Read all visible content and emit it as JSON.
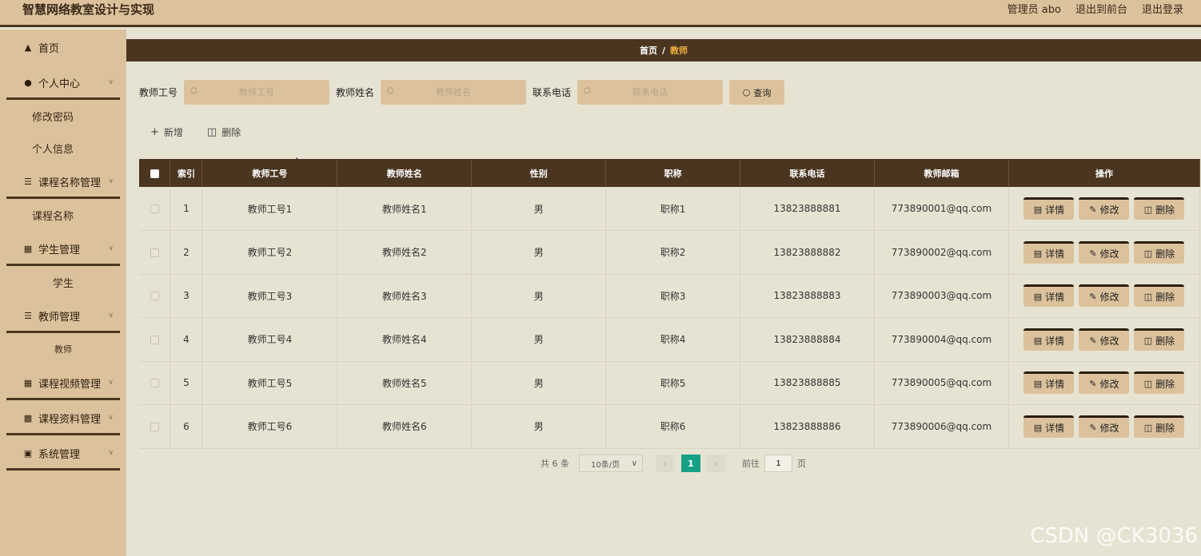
{
  "header": {
    "title": "智慧网络教室设计与实现",
    "admin": "管理员 abo",
    "to_front": "退出到前台",
    "logout": "退出登录"
  },
  "sidebar": {
    "home": "首页",
    "personal_center": "个人中心",
    "change_password": "修改密码",
    "personal_info": "个人信息",
    "course_name_mgmt": "课程名称管理",
    "course_name": "课程名称",
    "student_mgmt": "学生管理",
    "student": "学生",
    "teacher_mgmt": "教师管理",
    "teacher": "教师",
    "course_video_mgmt": "课程视频管理",
    "course_material_mgmt": "课程资料管理",
    "system_mgmt": "系统管理"
  },
  "breadcrumb": {
    "home": "首页",
    "separator": "/",
    "current": "教师"
  },
  "search": {
    "teacher_no_label": "教师工号",
    "teacher_no_placeholder": "教师工号",
    "teacher_name_label": "教师姓名",
    "teacher_name_placeholder": "教师姓名",
    "phone_label": "联系电话",
    "phone_placeholder": "联系电话",
    "query_button": "查询"
  },
  "actions": {
    "add": "新增",
    "delete": "删除"
  },
  "table": {
    "columns": [
      "索引",
      "教师工号",
      "教师姓名",
      "性别",
      "职称",
      "联系电话",
      "教师邮箱",
      "操作"
    ],
    "rows": [
      {
        "index": "1",
        "no": "教师工号1",
        "name": "教师姓名1",
        "gender": "男",
        "title": "职称1",
        "phone": "13823888881",
        "email": "773890001@qq.com"
      },
      {
        "index": "2",
        "no": "教师工号2",
        "name": "教师姓名2",
        "gender": "男",
        "title": "职称2",
        "phone": "13823888882",
        "email": "773890002@qq.com"
      },
      {
        "index": "3",
        "no": "教师工号3",
        "name": "教师姓名3",
        "gender": "男",
        "title": "职称3",
        "phone": "13823888883",
        "email": "773890003@qq.com"
      },
      {
        "index": "4",
        "no": "教师工号4",
        "name": "教师姓名4",
        "gender": "男",
        "title": "职称4",
        "phone": "13823888884",
        "email": "773890004@qq.com"
      },
      {
        "index": "5",
        "no": "教师工号5",
        "name": "教师姓名5",
        "gender": "男",
        "title": "职称5",
        "phone": "13823888885",
        "email": "773890005@qq.com"
      },
      {
        "index": "6",
        "no": "教师工号6",
        "name": "教师姓名6",
        "gender": "男",
        "title": "职称6",
        "phone": "13823888886",
        "email": "773890006@qq.com"
      }
    ],
    "row_buttons": {
      "detail": "详情",
      "edit": "修改",
      "delete": "删除"
    }
  },
  "pagination": {
    "total": "共 6 条",
    "page_size": "10条/页",
    "current_page": "1",
    "goto_label": "前往",
    "goto_value": "1",
    "page_suffix": "页"
  },
  "watermark": "CSDN @CK3036",
  "icons": {
    "home": "home-icon",
    "user": "user-icon",
    "list": "list-icon",
    "grid": "grid-icon",
    "search": "search-icon",
    "plus": "plus-icon",
    "trash": "trash-icon",
    "detail": "document-icon",
    "edit": "pencil-icon"
  },
  "colors": {
    "header_bg": "#dcc29c",
    "dark_brown": "#4a3520",
    "content_bg": "#e6e3d2",
    "breadcrumb_current": "#f0b040",
    "active_page": "#16a085"
  }
}
